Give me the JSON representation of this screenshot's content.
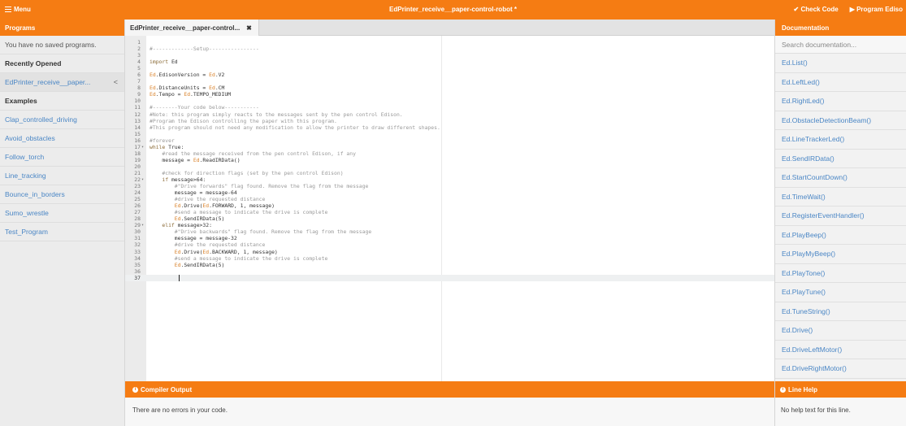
{
  "topbar": {
    "menu_label": "Menu",
    "title": "EdPrinter_receive__paper-control-robot *",
    "check_code": "✔ Check Code",
    "program_edison": "▶ Program Ediso"
  },
  "programs": {
    "header": "Programs",
    "no_saved": "You have no saved programs.",
    "recent_header": "Recently Opened",
    "recent_item": "EdPrinter_receive__paper...",
    "examples_header": "Examples",
    "examples": [
      "Clap_controlled_driving",
      "Avoid_obstacles",
      "Follow_torch",
      "Line_tracking",
      "Bounce_in_borders",
      "Sumo_wrestle",
      "Test_Program"
    ]
  },
  "editor": {
    "tab_label": "EdPrinter_receive__paper-control...",
    "tab_close": "✖",
    "lines": [
      "",
      "#-------------Setup----------------",
      "",
      "import Ed",
      "",
      "Ed.EdisonVersion = Ed.V2",
      "",
      "Ed.DistanceUnits = Ed.CM",
      "Ed.Tempo = Ed.TEMPO_MEDIUM",
      "",
      "#--------Your code below-----------",
      "#Note: this program simply reacts to the messages sent by the pen control Edison.",
      "#Program the Edison controlling the paper with this program.",
      "#This program should not need any modification to allow the printer to draw different shapes.",
      "",
      "#forever",
      "while True:",
      "    #read the message received from the pen control Edison, if any",
      "    message = Ed.ReadIRData()",
      "",
      "    #check for direction flags (set by the pen control Edison)",
      "    if message>64:",
      "        #\"Drive forwards\" flag found. Remove the flag from the message",
      "        message = message-64",
      "        #drive the requested distance",
      "        Ed.Drive(Ed.FORWARD, 1, message)",
      "        #send a message to indicate the drive is complete",
      "        Ed.SendIRData(5)",
      "    elif message>32:",
      "        #\"Drive backwards\" flag found. Remove the flag from the message",
      "        message = message-32",
      "        #drive the requested distance",
      "        Ed.Drive(Ed.BACKWARD, 1, message)",
      "        #send a message to indicate the drive is complete",
      "        Ed.SendIRData(5)",
      "",
      ""
    ],
    "fold_lines": [
      17,
      22,
      29
    ],
    "active_line": 37
  },
  "compiler": {
    "header": "Compiler Output",
    "message": "There are no errors in your code."
  },
  "documentation": {
    "header": "Documentation",
    "search_placeholder": "Search documentation...",
    "items": [
      "Ed.List()",
      "Ed.LeftLed()",
      "Ed.RightLed()",
      "Ed.ObstacleDetectionBeam()",
      "Ed.LineTrackerLed()",
      "Ed.SendIRData()",
      "Ed.StartCountDown()",
      "Ed.TimeWait()",
      "Ed.RegisterEventHandler()",
      "Ed.PlayBeep()",
      "Ed.PlayMyBeep()",
      "Ed.PlayTone()",
      "Ed.PlayTune()",
      "Ed.TuneString()",
      "Ed.Drive()",
      "Ed.DriveLeftMotor()",
      "Ed.DriveRightMotor()"
    ]
  },
  "line_help": {
    "header": "Line Help",
    "message": "No help text for this line."
  }
}
